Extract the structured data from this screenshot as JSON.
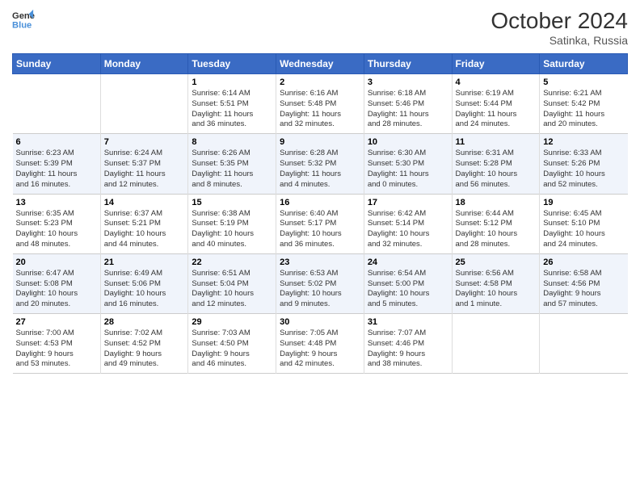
{
  "logo": {
    "line1": "General",
    "line2": "Blue"
  },
  "title": "October 2024",
  "subtitle": "Satinka, Russia",
  "days_header": [
    "Sunday",
    "Monday",
    "Tuesday",
    "Wednesday",
    "Thursday",
    "Friday",
    "Saturday"
  ],
  "weeks": [
    [
      {
        "num": "",
        "info": ""
      },
      {
        "num": "",
        "info": ""
      },
      {
        "num": "1",
        "info": "Sunrise: 6:14 AM\nSunset: 5:51 PM\nDaylight: 11 hours\nand 36 minutes."
      },
      {
        "num": "2",
        "info": "Sunrise: 6:16 AM\nSunset: 5:48 PM\nDaylight: 11 hours\nand 32 minutes."
      },
      {
        "num": "3",
        "info": "Sunrise: 6:18 AM\nSunset: 5:46 PM\nDaylight: 11 hours\nand 28 minutes."
      },
      {
        "num": "4",
        "info": "Sunrise: 6:19 AM\nSunset: 5:44 PM\nDaylight: 11 hours\nand 24 minutes."
      },
      {
        "num": "5",
        "info": "Sunrise: 6:21 AM\nSunset: 5:42 PM\nDaylight: 11 hours\nand 20 minutes."
      }
    ],
    [
      {
        "num": "6",
        "info": "Sunrise: 6:23 AM\nSunset: 5:39 PM\nDaylight: 11 hours\nand 16 minutes."
      },
      {
        "num": "7",
        "info": "Sunrise: 6:24 AM\nSunset: 5:37 PM\nDaylight: 11 hours\nand 12 minutes."
      },
      {
        "num": "8",
        "info": "Sunrise: 6:26 AM\nSunset: 5:35 PM\nDaylight: 11 hours\nand 8 minutes."
      },
      {
        "num": "9",
        "info": "Sunrise: 6:28 AM\nSunset: 5:32 PM\nDaylight: 11 hours\nand 4 minutes."
      },
      {
        "num": "10",
        "info": "Sunrise: 6:30 AM\nSunset: 5:30 PM\nDaylight: 11 hours\nand 0 minutes."
      },
      {
        "num": "11",
        "info": "Sunrise: 6:31 AM\nSunset: 5:28 PM\nDaylight: 10 hours\nand 56 minutes."
      },
      {
        "num": "12",
        "info": "Sunrise: 6:33 AM\nSunset: 5:26 PM\nDaylight: 10 hours\nand 52 minutes."
      }
    ],
    [
      {
        "num": "13",
        "info": "Sunrise: 6:35 AM\nSunset: 5:23 PM\nDaylight: 10 hours\nand 48 minutes."
      },
      {
        "num": "14",
        "info": "Sunrise: 6:37 AM\nSunset: 5:21 PM\nDaylight: 10 hours\nand 44 minutes."
      },
      {
        "num": "15",
        "info": "Sunrise: 6:38 AM\nSunset: 5:19 PM\nDaylight: 10 hours\nand 40 minutes."
      },
      {
        "num": "16",
        "info": "Sunrise: 6:40 AM\nSunset: 5:17 PM\nDaylight: 10 hours\nand 36 minutes."
      },
      {
        "num": "17",
        "info": "Sunrise: 6:42 AM\nSunset: 5:14 PM\nDaylight: 10 hours\nand 32 minutes."
      },
      {
        "num": "18",
        "info": "Sunrise: 6:44 AM\nSunset: 5:12 PM\nDaylight: 10 hours\nand 28 minutes."
      },
      {
        "num": "19",
        "info": "Sunrise: 6:45 AM\nSunset: 5:10 PM\nDaylight: 10 hours\nand 24 minutes."
      }
    ],
    [
      {
        "num": "20",
        "info": "Sunrise: 6:47 AM\nSunset: 5:08 PM\nDaylight: 10 hours\nand 20 minutes."
      },
      {
        "num": "21",
        "info": "Sunrise: 6:49 AM\nSunset: 5:06 PM\nDaylight: 10 hours\nand 16 minutes."
      },
      {
        "num": "22",
        "info": "Sunrise: 6:51 AM\nSunset: 5:04 PM\nDaylight: 10 hours\nand 12 minutes."
      },
      {
        "num": "23",
        "info": "Sunrise: 6:53 AM\nSunset: 5:02 PM\nDaylight: 10 hours\nand 9 minutes."
      },
      {
        "num": "24",
        "info": "Sunrise: 6:54 AM\nSunset: 5:00 PM\nDaylight: 10 hours\nand 5 minutes."
      },
      {
        "num": "25",
        "info": "Sunrise: 6:56 AM\nSunset: 4:58 PM\nDaylight: 10 hours\nand 1 minute."
      },
      {
        "num": "26",
        "info": "Sunrise: 6:58 AM\nSunset: 4:56 PM\nDaylight: 9 hours\nand 57 minutes."
      }
    ],
    [
      {
        "num": "27",
        "info": "Sunrise: 7:00 AM\nSunset: 4:53 PM\nDaylight: 9 hours\nand 53 minutes."
      },
      {
        "num": "28",
        "info": "Sunrise: 7:02 AM\nSunset: 4:52 PM\nDaylight: 9 hours\nand 49 minutes."
      },
      {
        "num": "29",
        "info": "Sunrise: 7:03 AM\nSunset: 4:50 PM\nDaylight: 9 hours\nand 46 minutes."
      },
      {
        "num": "30",
        "info": "Sunrise: 7:05 AM\nSunset: 4:48 PM\nDaylight: 9 hours\nand 42 minutes."
      },
      {
        "num": "31",
        "info": "Sunrise: 7:07 AM\nSunset: 4:46 PM\nDaylight: 9 hours\nand 38 minutes."
      },
      {
        "num": "",
        "info": ""
      },
      {
        "num": "",
        "info": ""
      }
    ]
  ]
}
